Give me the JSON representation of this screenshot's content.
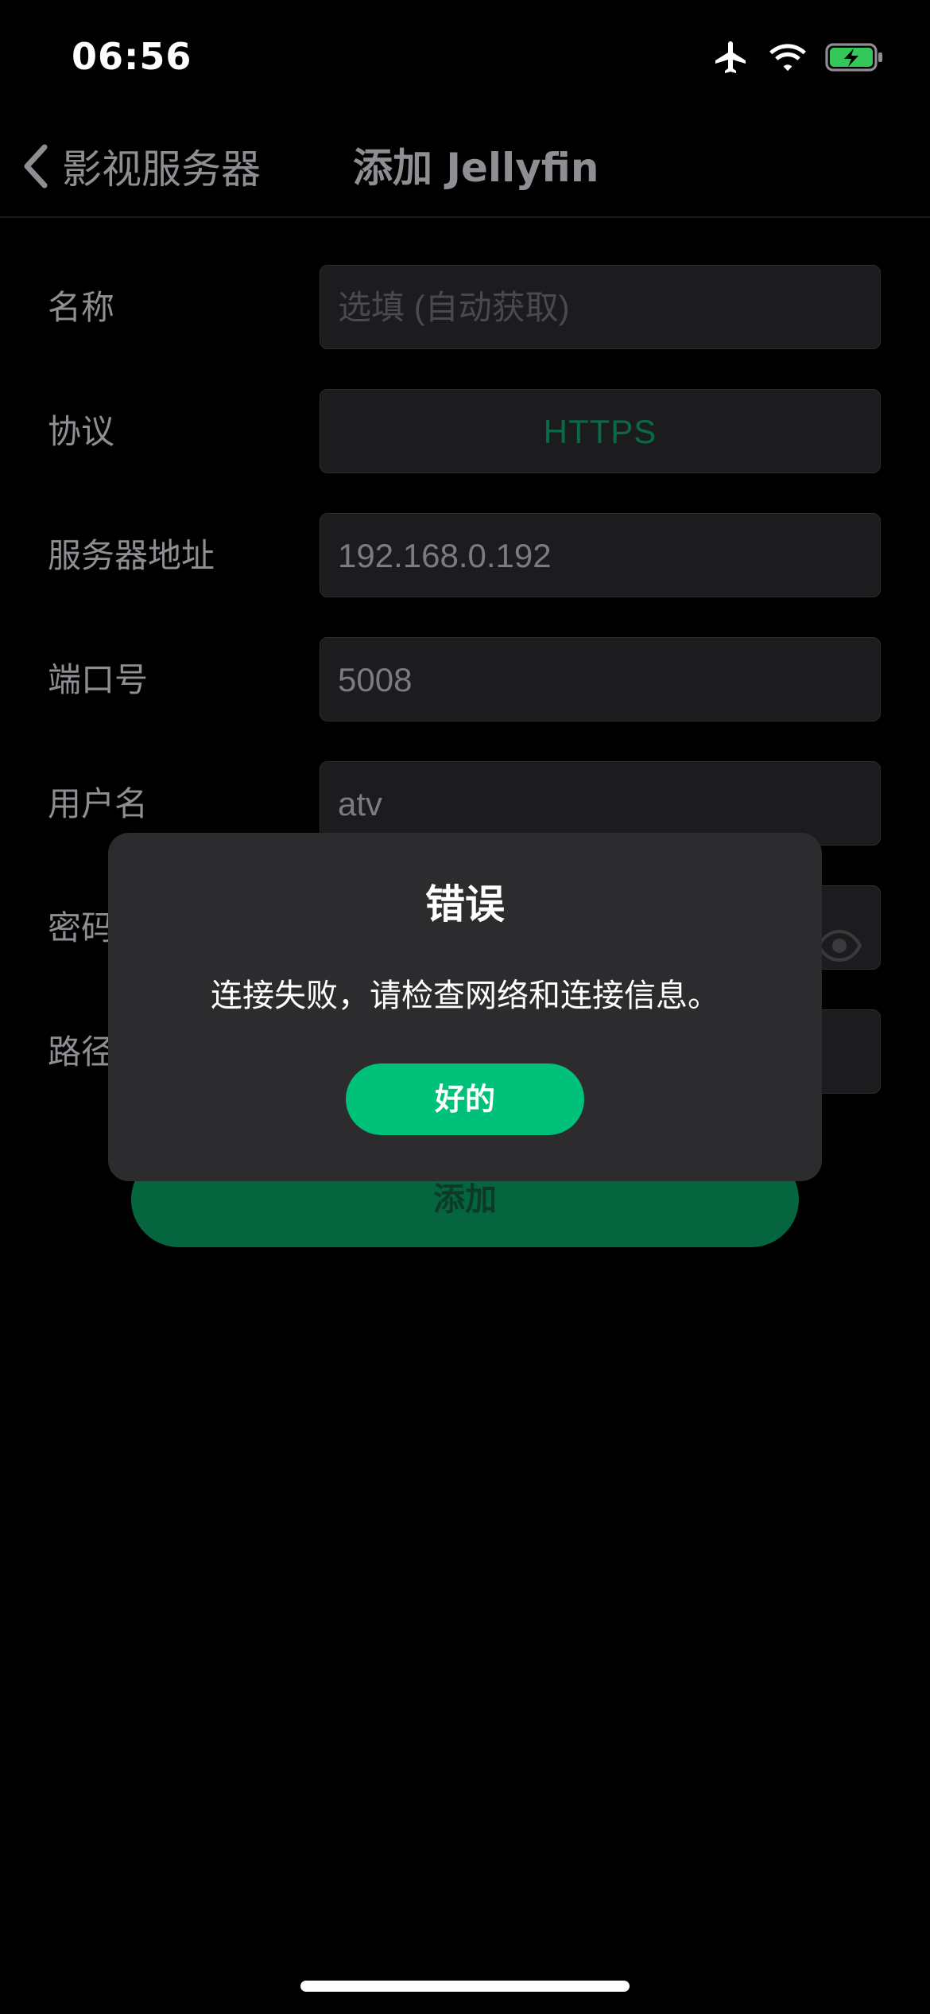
{
  "status": {
    "time": "06:56",
    "icons": [
      "airplane-icon",
      "wifi-icon",
      "battery-charging-icon"
    ]
  },
  "nav": {
    "back_label": "影视服务器",
    "title": "添加 Jellyfin"
  },
  "form": {
    "name_label": "名称",
    "name_placeholder": "选填 (自动获取)",
    "protocol_label": "协议",
    "protocol_value": "HTTPS",
    "address_label": "服务器地址",
    "address_value": "192.168.0.192",
    "port_label": "端口号",
    "port_value": "5008",
    "username_label": "用户名",
    "username_value": "atv",
    "password_label": "密码",
    "path_label": "路径",
    "submit_label": "添加"
  },
  "alert": {
    "title": "错误",
    "message": "连接失败，请检查网络和连接信息。",
    "ok_label": "好的"
  },
  "colors": {
    "accent": "#00c17a",
    "background": "#000000",
    "field": "#1c1c1e",
    "dialog": "#2c2c2e"
  }
}
